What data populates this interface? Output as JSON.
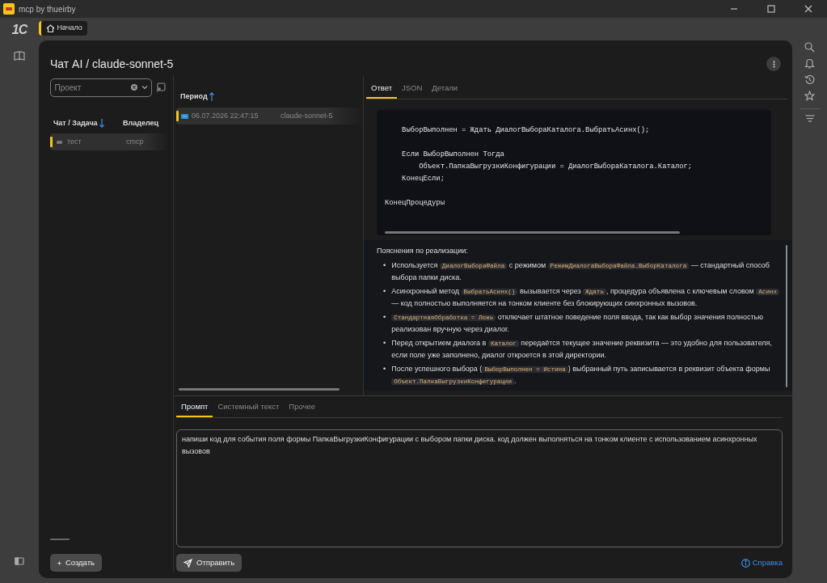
{
  "window": {
    "title": "mcp by thueirby"
  },
  "logo": "1С",
  "home_tab": {
    "label": "Начало",
    "selected": true
  },
  "page_title": "Чат AI / claude-sonnet-5",
  "project_field": {
    "placeholder": "Проект"
  },
  "chats": {
    "columns": [
      {
        "label": "Чат / Задача",
        "sort_descending": true
      },
      {
        "label": "Владелец"
      }
    ],
    "rows": [
      {
        "name": "тест",
        "owner": "cmcp",
        "selected": true
      }
    ]
  },
  "periods": {
    "column": {
      "label": "Период",
      "sort_descending": false
    },
    "rows": [
      {
        "period": "06.07.2026 22:47:15",
        "model": "claude-sonnet-5",
        "selected": true
      }
    ]
  },
  "response_tabs": [
    {
      "label": "Ответ",
      "selected": true
    },
    {
      "label": "JSON",
      "selected": false
    },
    {
      "label": "Детали",
      "selected": false
    }
  ],
  "code_blocks": [
    [
      "    ВыборВыполнен = Ждать ДиалогВыбораКаталога.ВыбратьАсинх();"
    ],
    [
      "    Если ВыборВыполнен Тогда",
      "        Объект.ПапкаВыгрузкиКонфигурации = ДиалогВыбораКаталога.Каталог;",
      "    КонецЕсли;"
    ],
    [
      "КонецПроцедуры"
    ]
  ],
  "notes_heading": "Пояснения по реализации:",
  "notes": [
    {
      "marker": "•",
      "segments": [
        {
          "kind": "text",
          "text": "Используется "
        },
        {
          "kind": "code",
          "text": "ДиалогВыбораФайла"
        },
        {
          "kind": "text",
          "text": " с режимом "
        },
        {
          "kind": "code",
          "text": "РежимДиалогаВыбораФайла.ВыборКаталога"
        },
        {
          "kind": "text",
          "text": " — стандартный способ выбора папки диска."
        }
      ]
    },
    {
      "marker": "•",
      "segments": [
        {
          "kind": "text",
          "text": "Асинхронный метод "
        },
        {
          "kind": "code",
          "text": "ВыбратьАсинх()"
        },
        {
          "kind": "text",
          "text": " вызывается через "
        },
        {
          "kind": "code",
          "text": "Ждать"
        },
        {
          "kind": "text",
          "text": ", процедура объявлена с ключевым словом "
        },
        {
          "kind": "code",
          "text": "Асинх"
        },
        {
          "kind": "text",
          "text": " — код полностью выполняется на тонком клиенте без блокирующих синхронных вызовов."
        }
      ]
    },
    {
      "marker": "•",
      "segments": [
        {
          "kind": "code",
          "text": "СтандартнаяОбработка = Ложь"
        },
        {
          "kind": "text",
          "text": " отключает штатное поведение поля ввода, так как выбор значения полностью реализован вручную через диалог."
        }
      ]
    },
    {
      "marker": "•",
      "segments": [
        {
          "kind": "text",
          "text": "Перед открытием диалога в "
        },
        {
          "kind": "code",
          "text": "Каталог"
        },
        {
          "kind": "text",
          "text": " передаётся текущее значение реквизита — это удобно для пользователя, если поле уже заполнено, диалог откроется в этой директории."
        }
      ]
    },
    {
      "marker": "•",
      "segments": [
        {
          "kind": "text",
          "text": "После успешного выбора ("
        },
        {
          "kind": "code",
          "text": "ВыборВыполнен = Истина"
        },
        {
          "kind": "text",
          "text": ") выбранный путь записывается в реквизит объекта формы "
        },
        {
          "kind": "code",
          "text": "Объект.ПапкаВыгрузкиКонфигурации"
        },
        {
          "kind": "text",
          "text": "."
        }
      ]
    }
  ],
  "prompt_tabs": [
    {
      "label": "Промпт",
      "selected": true
    },
    {
      "label": "Системный текст",
      "selected": false
    },
    {
      "label": "Прочее",
      "selected": false
    }
  ],
  "prompt": {
    "value": "напиши код для события поля формы ПапкаВыгрузкиКонфигурации с выбором папки диска. код должен выполняться на тонком клиенте с использованием асинхронных вызовов"
  },
  "create_button": "Создать",
  "send_button": "Отправить",
  "help_link": "Справка"
}
